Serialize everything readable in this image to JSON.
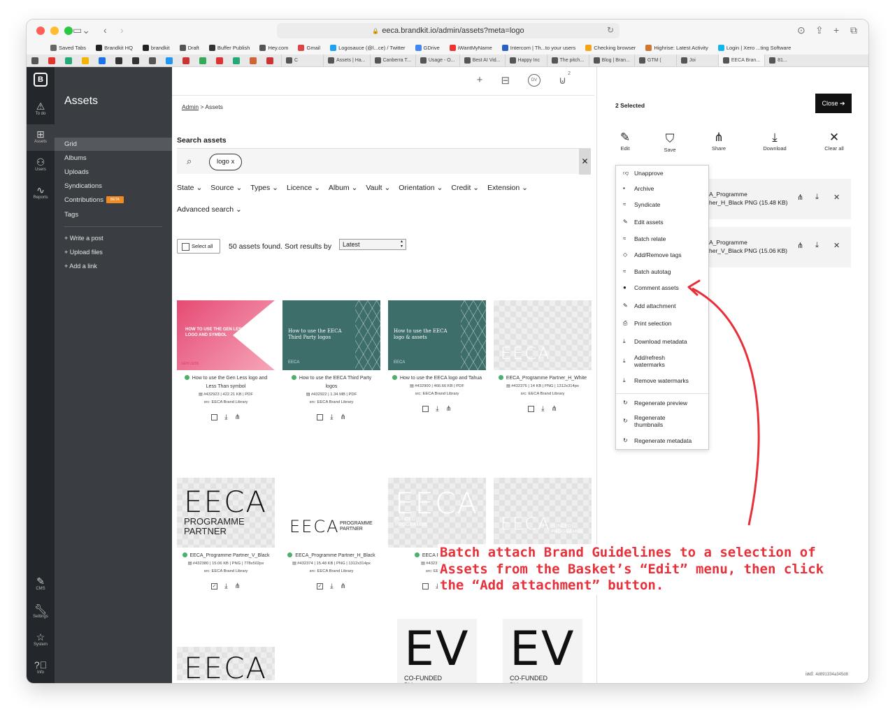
{
  "browser": {
    "url": "eeca.brandkit.io/admin/assets?meta=logo",
    "bookmarks": [
      "Saved Tabs",
      "Brandkit HQ",
      "brandkit",
      "Draft",
      "Buffer Publish",
      "Hey.com",
      "Gmail",
      "Logosauce (@l...ce) / Twitter",
      "GDrive",
      "iWantMyName",
      "Intercom | Th...to your users",
      "Checking browser",
      "Highrise: Latest Activity",
      "Login | Xero ...ting Software"
    ],
    "tabs": [
      "C",
      "Assets | Ha...",
      "Canberra T...",
      "Usage - O...",
      "Best AI Vid...",
      "Happy Inc",
      "The pitch...",
      "Blog | Bran...",
      "GTM (",
      "Joi",
      "EECA Bran...",
      "81..."
    ]
  },
  "rail": {
    "logo": "B",
    "items": [
      "To do",
      "Assets",
      "Users",
      "Reports",
      "CMS",
      "Settings",
      "System",
      "Info"
    ]
  },
  "sidenav": {
    "title": "Assets",
    "items": [
      "Grid",
      "Albums",
      "Uploads",
      "Syndications",
      "Contributions",
      "Tags"
    ],
    "beta": "BETA",
    "actions": [
      "+ Write a post",
      "+ Upload files",
      "+ Add a link"
    ]
  },
  "main": {
    "topbar_badge": "2",
    "breadcrumb": {
      "root": "Admin",
      "sep": ">",
      "current": "Assets"
    },
    "search_label": "Search assets",
    "chip": "logo  x",
    "clear": "✕",
    "filters": [
      "State",
      "Source",
      "Types",
      "Licence",
      "Album",
      "Vault",
      "Orientation",
      "Credit",
      "Extension"
    ],
    "advanced": "Advanced search",
    "select_all": "Select all",
    "found": "50 assets found. Sort results by",
    "sort": "Latest",
    "cards": [
      {
        "title": "How to use the Gen Less logo and Less Than symbol",
        "meta": "#432923 | 422.21 KB | PDF",
        "src": "src: EECA Brand Library",
        "thumb_text": "HOW TO USE THE GEN LESS LOGO AND SYMBOL"
      },
      {
        "title": "How to use the EECA Third Party logos",
        "meta": "#432922 | 1.34 MB | PDF",
        "src": "src: EECA Brand Library",
        "thumb_text": "How to use the EECA Third Party logos"
      },
      {
        "title": "How to use the EECA logo and Tahua",
        "meta": "#432900 | 466.66 KB | PDF",
        "src": "src: EECA Brand Library",
        "thumb_text": "How to use the EECA logo & assets"
      },
      {
        "title": "EECA_Programme Partner_H_White",
        "meta": "#432376 | 14 KB | PNG | 1312x314px",
        "src": "src: EECA Brand Library",
        "thumb_text": "EECA"
      },
      {
        "title": "EECA_Programme Partner_V_Black",
        "meta": "#432380 | 15.06 KB | PNG | 778x502px",
        "src": "src: EECA Brand Library",
        "thumb_text": "EECA",
        "thumb_sub": "PROGRAMME PARTNER"
      },
      {
        "title": "EECA_Programme Partner_H_Black",
        "meta": "#432374 | 15.48 KB | PNG | 1312x314px",
        "src": "src: EECA Brand Library",
        "thumb_text": "EECA",
        "thumb_sub": "PROGRAMME PARTNER"
      },
      {
        "title": "EECA Programm",
        "meta": "#432375 | 13.2",
        "src": "src: EECA E",
        "thumb_text": "EECA",
        "thumb_sub": "FUNDED PROGRAMME"
      },
      {
        "title": "",
        "meta": "",
        "src": "",
        "thumb_text": "EECA",
        "thumb_sub": "FUNDED PROGRAMME"
      },
      {
        "title": "",
        "meta": "",
        "src": "",
        "thumb_text": "EECA"
      },
      {
        "title": "",
        "meta": "",
        "src": "",
        "thumb_text": "EV",
        "thumb_sub": "CO-FUNDED BY"
      },
      {
        "title": "",
        "meta": "",
        "src": "",
        "thumb_text": "EV",
        "thumb_sub": "CO-FUNDED BY"
      }
    ],
    "thumb_brand": "EECA",
    "thumb_brand_small": "GEN LESS"
  },
  "panel": {
    "selected": "2 Selected",
    "close": "Close ➔",
    "actions": [
      "Edit",
      "Save",
      "Share",
      "Download",
      "Clear all"
    ],
    "selected_items": [
      {
        "name_line1": "A_Programme",
        "name_line2": "her_H_Black PNG (15.48 KB)"
      },
      {
        "name_line1": "A_Programme",
        "name_line2": "her_V_Black PNG (15.06 KB)"
      }
    ],
    "menu": [
      "Unapprove",
      "Archive",
      "Syndicate",
      "Edit assets",
      "Batch relate",
      "Add/Remove tags",
      "Batch autotag",
      "Comment assets",
      "Add attachment",
      "Print selection",
      "Download metadata",
      "Add/refresh watermarks",
      "Remove watermarks",
      "Regenerate preview",
      "Regenerate thumbnails",
      "Regenerate metadata"
    ],
    "iad_label": "iad:",
    "iad_value": "4d891334a345d8"
  },
  "annotation": "Batch attach Brand Guidelines to a selection of Assets from the Basket’s “Edit” menu, then click the “Add attachment” button.",
  "colors": {
    "accent": "#e8303a",
    "rail": "#23262a",
    "sidenav": "#3a3d42",
    "teal": "#3d6e6a",
    "pink": "#e54b74",
    "beta": "#f08a24"
  }
}
